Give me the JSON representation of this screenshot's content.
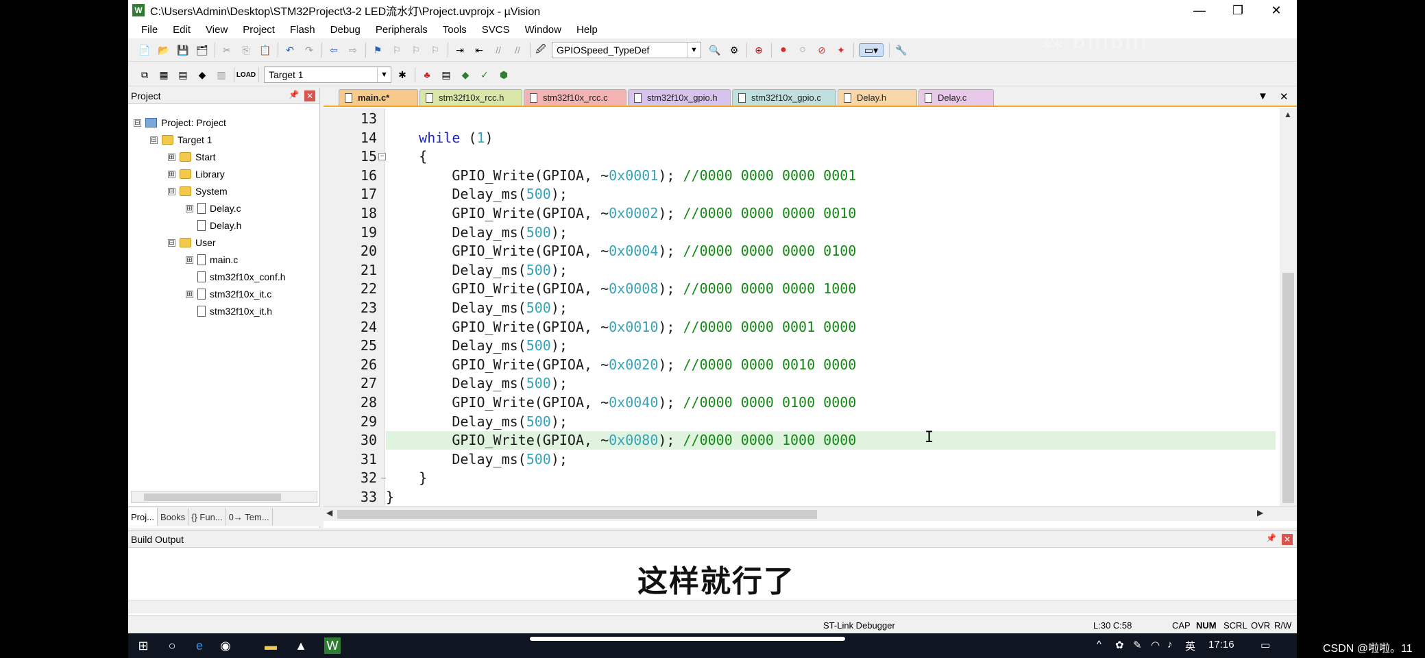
{
  "window": {
    "title": "C:\\Users\\Admin\\Desktop\\STM32Project\\3-2 LED流水灯\\Project.uvprojx - µVision",
    "app_icon": "W",
    "controls": {
      "minimize": "—",
      "restore": "❐",
      "close": "✕"
    }
  },
  "menu": [
    "File",
    "Edit",
    "View",
    "Project",
    "Flash",
    "Debug",
    "Peripherals",
    "Tools",
    "SVCS",
    "Window",
    "Help"
  ],
  "toolbar1": {
    "function_combo": "GPIOSpeed_TypeDef"
  },
  "toolbar2": {
    "target_combo": "Target 1"
  },
  "project_panel": {
    "title": "Project",
    "tree": [
      {
        "label": "Project: Project",
        "kind": "project",
        "exp": "⊟"
      },
      {
        "label": "Target 1",
        "kind": "folder",
        "exp": "⊟"
      },
      {
        "label": "Start",
        "kind": "folder",
        "exp": "⊞"
      },
      {
        "label": "Library",
        "kind": "folder",
        "exp": "⊞"
      },
      {
        "label": "System",
        "kind": "folder",
        "exp": "⊟"
      },
      {
        "label": "Delay.c",
        "kind": "file",
        "exp": "⊞"
      },
      {
        "label": "Delay.h",
        "kind": "file",
        "exp": ""
      },
      {
        "label": "User",
        "kind": "folder",
        "exp": "⊟"
      },
      {
        "label": "main.c",
        "kind": "file",
        "exp": "⊞"
      },
      {
        "label": "stm32f10x_conf.h",
        "kind": "file",
        "exp": ""
      },
      {
        "label": "stm32f10x_it.c",
        "kind": "file",
        "exp": "⊞"
      },
      {
        "label": "stm32f10x_it.h",
        "kind": "file",
        "exp": ""
      }
    ],
    "tabs": [
      "Proj...",
      "Books",
      "{} Fun...",
      "0→ Tem..."
    ]
  },
  "editor": {
    "tabs": [
      {
        "label": "main.c*",
        "color": "#f7c98b",
        "active": true
      },
      {
        "label": "stm32f10x_rcc.h",
        "color": "#d9e8a8"
      },
      {
        "label": "stm32f10x_rcc.c",
        "color": "#f4b3b3"
      },
      {
        "label": "stm32f10x_gpio.h",
        "color": "#d6c3ee"
      },
      {
        "label": "stm32f10x_gpio.c",
        "color": "#bfe0df"
      },
      {
        "label": "Delay.h",
        "color": "#f9d6a8"
      },
      {
        "label": "Delay.c",
        "color": "#e9c9e9"
      }
    ],
    "lines": [
      {
        "n": "13",
        "code": ""
      },
      {
        "n": "14",
        "code": "    while (1)"
      },
      {
        "n": "15",
        "code": "    {"
      },
      {
        "n": "16",
        "code": "        GPIO_Write(GPIOA, ~0x0001); //0000 0000 0000 0001"
      },
      {
        "n": "17",
        "code": "        Delay_ms(500);"
      },
      {
        "n": "18",
        "code": "        GPIO_Write(GPIOA, ~0x0002); //0000 0000 0000 0010"
      },
      {
        "n": "19",
        "code": "        Delay_ms(500);"
      },
      {
        "n": "20",
        "code": "        GPIO_Write(GPIOA, ~0x0004); //0000 0000 0000 0100"
      },
      {
        "n": "21",
        "code": "        Delay_ms(500);"
      },
      {
        "n": "22",
        "code": "        GPIO_Write(GPIOA, ~0x0008); //0000 0000 0000 1000"
      },
      {
        "n": "23",
        "code": "        Delay_ms(500);"
      },
      {
        "n": "24",
        "code": "        GPIO_Write(GPIOA, ~0x0010); //0000 0000 0001 0000"
      },
      {
        "n": "25",
        "code": "        Delay_ms(500);"
      },
      {
        "n": "26",
        "code": "        GPIO_Write(GPIOA, ~0x0020); //0000 0000 0010 0000"
      },
      {
        "n": "27",
        "code": "        Delay_ms(500);"
      },
      {
        "n": "28",
        "code": "        GPIO_Write(GPIOA, ~0x0040); //0000 0000 0100 0000"
      },
      {
        "n": "29",
        "code": "        Delay_ms(500);"
      },
      {
        "n": "30",
        "code": "        GPIO_Write(GPIOA, ~0x0080); //0000 0000 1000 0000",
        "highlight": true
      },
      {
        "n": "31",
        "code": "        Delay_ms(500);"
      },
      {
        "n": "32",
        "code": "    }"
      },
      {
        "n": "33",
        "code": "}"
      }
    ]
  },
  "build_output": {
    "title": "Build Output"
  },
  "status": {
    "debugger": "ST-Link Debugger",
    "cursor": "L:30 C:58",
    "cap": "CAP",
    "num": "NUM",
    "scrl": "SCRL",
    "ovr": "OVR",
    "rw": "R/W"
  },
  "overlay": {
    "subtitle": "这样就行了",
    "viewers": "28 人正在看"
  },
  "taskbar": {
    "ime": "英",
    "time": "17:16"
  },
  "credit": "CSDN @啦啦。11"
}
